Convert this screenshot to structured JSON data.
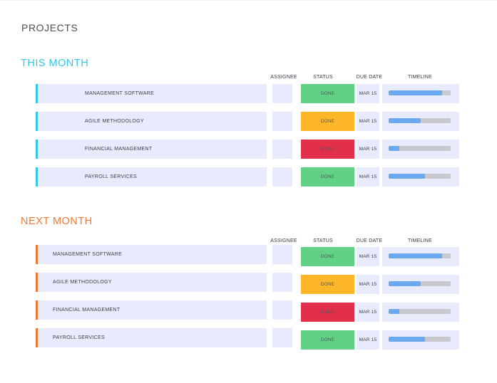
{
  "page_title": "PROJECTS",
  "columns": {
    "assignee": "ASSIGNEE",
    "status": "STATUS",
    "due_date": "DUE DATE",
    "timeline": "TIMELINE"
  },
  "colors": {
    "this_month_accent": "#36c6e8",
    "next_month_accent": "#ee7a32",
    "status_done_green": "#61d185",
    "status_done_yellow": "#fdb628",
    "status_done_red": "#e2304a",
    "row_bg": "#e8ebfb",
    "timeline_fill": "#6aa8ef",
    "timeline_track": "#c8c8cd"
  },
  "sections": [
    {
      "title": "THIS MONTH",
      "accent": "#36c6e8",
      "rows": [
        {
          "name": "MANAGEMENT SOFTWARE",
          "assignee": "",
          "status": "DONE",
          "status_color": "#61d185",
          "due": "MAR 15",
          "progress": 0.86
        },
        {
          "name": "AGILE METHODOLOGY",
          "assignee": "",
          "status": "DONE",
          "status_color": "#fdb628",
          "due": "MAR 15",
          "progress": 0.52
        },
        {
          "name": "FINANCIAL MANAGEMENT",
          "assignee": "",
          "status": "DONE",
          "status_color": "#e2304a",
          "due": "MAR 15",
          "progress": 0.17
        },
        {
          "name": "PAYROLL SERVICES",
          "assignee": "",
          "status": "DONE",
          "status_color": "#61d185",
          "due": "MAR 15",
          "progress": 0.59
        }
      ]
    },
    {
      "title": "NEXT MONTH",
      "accent": "#ee7a32",
      "rows": [
        {
          "name": "MANAGEMENT SOFTWARE",
          "assignee": "",
          "status": "DONE",
          "status_color": "#61d185",
          "due": "MAR 15",
          "progress": 0.86
        },
        {
          "name": "AGILE METHODOLOGY",
          "assignee": "",
          "status": "DONE",
          "status_color": "#fdb628",
          "due": "MAR 15",
          "progress": 0.52
        },
        {
          "name": "FINANCIAL MANAGEMENT",
          "assignee": "",
          "status": "DONE",
          "status_color": "#e2304a",
          "due": "MAR 15",
          "progress": 0.17
        },
        {
          "name": "PAYROLL SERVICES",
          "assignee": "",
          "status": "DONE",
          "status_color": "#61d185",
          "due": "MAR 15",
          "progress": 0.59
        }
      ]
    }
  ]
}
